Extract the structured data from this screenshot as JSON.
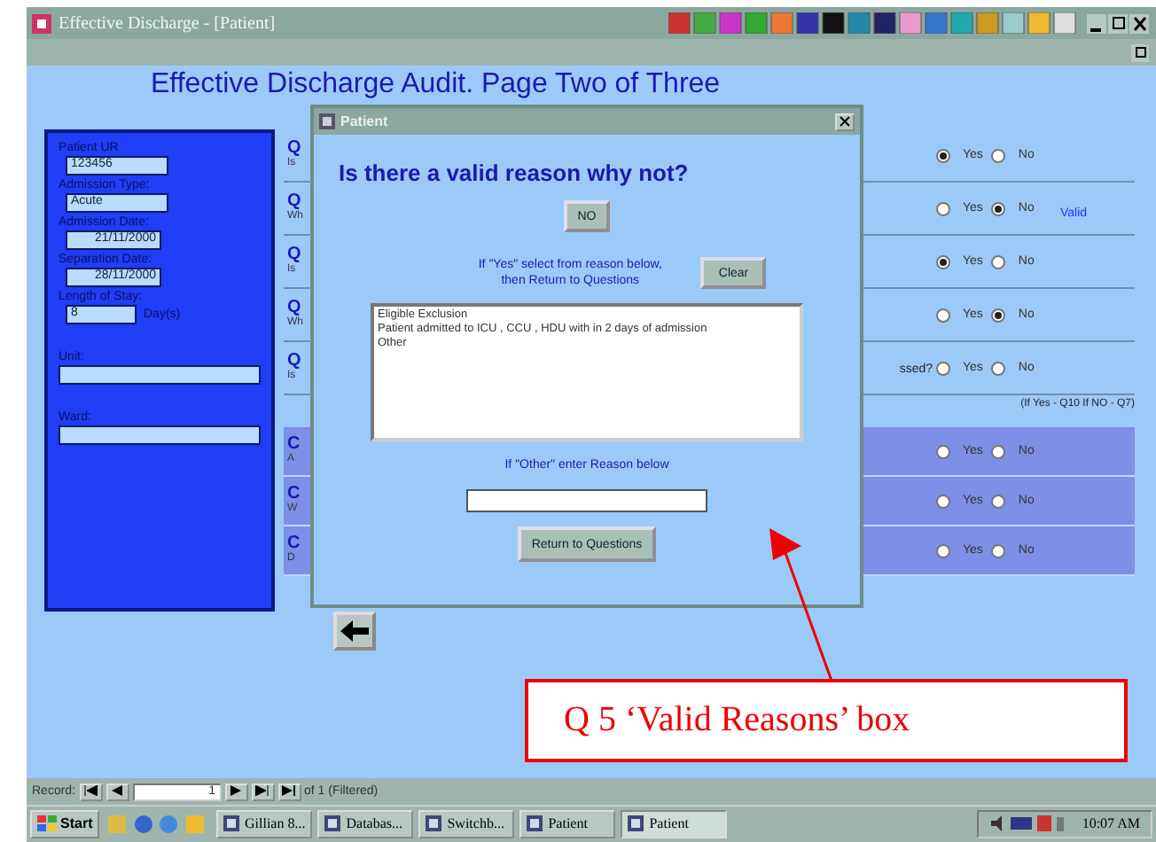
{
  "window": {
    "title": "Effective Discharge - [Patient]"
  },
  "form": {
    "heading": "Effective Discharge Audit.  Page Two of Three"
  },
  "patient": {
    "fields": [
      {
        "label": "Patient UR",
        "value": "123456",
        "kind": "text"
      },
      {
        "label": "Admission Type:",
        "value": "Acute",
        "kind": "combo"
      },
      {
        "label": "Admission Date:",
        "value": "21/11/2000",
        "kind": "date"
      },
      {
        "label": "Separation Date:",
        "value": "28/11/2000",
        "kind": "date"
      },
      {
        "label": "Length of Stay:",
        "value": "8",
        "suffix": "Day(s)",
        "kind": "short"
      },
      {
        "label": "Unit:",
        "kind": "wide"
      },
      {
        "label": "Ward:",
        "kind": "wide"
      }
    ]
  },
  "questions": [
    {
      "label": "Q",
      "text": "Is",
      "kind": "main",
      "options": [
        {
          "label": "Yes",
          "selected": true
        },
        {
          "label": "No",
          "selected": false
        }
      ]
    },
    {
      "label": "Q",
      "text": "Wh",
      "kind": "main",
      "flag": "Valid",
      "options": [
        {
          "label": "Yes",
          "selected": false
        },
        {
          "label": "No",
          "selected": true
        }
      ]
    },
    {
      "label": "Q",
      "text": "Is",
      "kind": "main",
      "options": [
        {
          "label": "Yes",
          "selected": true
        },
        {
          "label": "No",
          "selected": false
        }
      ]
    },
    {
      "label": "Q",
      "text": "Wh",
      "kind": "main",
      "options": [
        {
          "label": "Yes",
          "selected": false
        },
        {
          "label": "No",
          "selected": true
        }
      ]
    },
    {
      "label": "Q",
      "text": "Is",
      "tail": "ssed?",
      "note": "(If Yes - Q10 If NO - Q7)",
      "kind": "main",
      "options": [
        {
          "label": "Yes",
          "selected": false
        },
        {
          "label": "No",
          "selected": false
        }
      ]
    },
    {
      "label": "C",
      "text": "A",
      "kind": "extra",
      "options": [
        {
          "label": "Yes",
          "selected": false
        },
        {
          "label": "No",
          "selected": false
        }
      ]
    },
    {
      "label": "C",
      "text": "W",
      "kind": "extra",
      "options": [
        {
          "label": "Yes",
          "selected": false
        },
        {
          "label": "No",
          "selected": false
        }
      ]
    },
    {
      "label": "C",
      "text": "D",
      "kind": "extra",
      "options": [
        {
          "label": "Yes",
          "selected": false
        },
        {
          "label": "No",
          "selected": false
        }
      ]
    }
  ],
  "dialog": {
    "title": "Patient",
    "question": "Is there a valid reason why not?",
    "no_button": "NO",
    "instruction": [
      "If \"Yes\" select from reason below,",
      "then Return to Questions"
    ],
    "clear_button": "Clear",
    "reasons": [
      {
        "label": "Eligible Exclusion",
        "selected": false
      },
      {
        "label": "Patient admitted to ICU , CCU , HDU  with in 2 days of admission",
        "selected": false
      },
      {
        "label": "Other",
        "selected": false
      }
    ],
    "other_label": "If \"Other\" enter Reason below",
    "return_button": "Return to Questions"
  },
  "record_nav": {
    "label": "Record:",
    "current": "1",
    "total": "of 1 (Filtered)"
  },
  "taskbar": {
    "start": "Start",
    "tasks": [
      {
        "label": "Gillian 8...",
        "selected": false
      },
      {
        "label": "Databas...",
        "selected": false
      },
      {
        "label": "Switchb...",
        "selected": false
      },
      {
        "label": "Patient",
        "selected": false
      },
      {
        "label": "Patient",
        "selected": true
      }
    ],
    "clock": "10:07 AM"
  },
  "annotation": {
    "text": "Q 5 ‘Valid Reasons’ box"
  }
}
